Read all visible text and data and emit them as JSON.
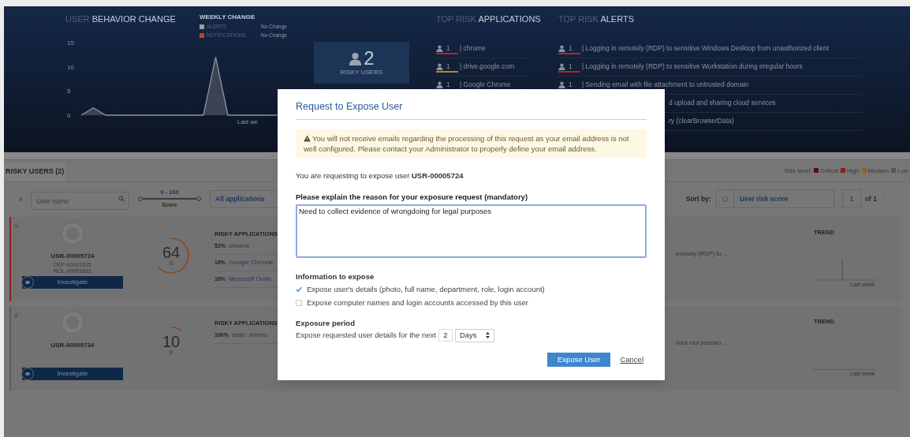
{
  "header": {
    "behavior": {
      "title": "USER **BEHAVIOR CHANGE**",
      "axis_labels": [
        "15",
        "10",
        "5",
        "0"
      ],
      "period_label": "Last we"
    },
    "weekly": {
      "title": "WEEKLY CHANGE",
      "rows": [
        {
          "label": "ALERTS",
          "value": "No Change",
          "color": "#9a9a9a"
        },
        {
          "label": "NOTIFICATIONS",
          "value": "No Change",
          "color": "#b5451f"
        }
      ]
    },
    "risky_users": {
      "count": "2",
      "label": "RISKY USERS"
    },
    "apps": {
      "title": "TOP RISK **APPLICATIONS**",
      "rows": [
        {
          "count": "1",
          "text": "| chrome",
          "color": "#b3262b"
        },
        {
          "count": "1",
          "text": "| drive.google.com",
          "color": "#c2861f"
        },
        {
          "count": "1",
          "text": "| Google Chrome"
        }
      ]
    },
    "alerts": {
      "title": "TOP RISK **ALERTS**",
      "rows": [
        {
          "count": "1",
          "text": "| Logging in remotely (RDP) to sensitive Windows Desktop from unauthorized client",
          "color": "#b3262b"
        },
        {
          "count": "1",
          "text": "| Logging in remotely (RDP) to sensitive Workstation during irregular hours",
          "color": "#b3262b"
        },
        {
          "count": "1",
          "text": "| Sending email with file attachment to untrusted domain"
        },
        {
          "text": "d upload and sharing cloud services"
        },
        {
          "text": "ry (clearBrowserData)"
        }
      ]
    }
  },
  "tab": {
    "label": "RISKY USERS (2)",
    "selected": true
  },
  "legend": {
    "label": "Risk level:",
    "items": [
      {
        "label": "Critical",
        "color": "#5a0d0d"
      },
      {
        "label": "High",
        "color": "#8f1c1c"
      },
      {
        "label": "Medium",
        "color": "#8f6420"
      },
      {
        "label": "Low",
        "color": "#555555"
      }
    ]
  },
  "filters": {
    "search": {
      "placeholder": "User name"
    },
    "score": {
      "range": "0 - 100",
      "label": "Score",
      "level": 1
    },
    "applications": "All applications",
    "sort_label": "Sort by:",
    "sort_value": "User risk score",
    "page": "1",
    "of": "of 1"
  },
  "users": [
    {
      "id": "USR-00005724",
      "dept": "DEP-90001625",
      "role": "ROL-90001631",
      "score": "64",
      "delta": "0",
      "color": "#8f2020",
      "action": "Investigate",
      "apps_title": "RISKY APPLICATIONS",
      "apps": [
        {
          "pct": "52%",
          "name": "chrome"
        },
        {
          "pct": "16%",
          "name": "Google Chrome"
        },
        {
          "pct": "16%",
          "name": "Microsoft Outlo"
        }
      ],
      "alert": "emotely (RDP) to ...",
      "trend": "TREND",
      "trend_label": "Last week"
    },
    {
      "id": "USR-00005734",
      "score": "10",
      "delta": "0",
      "color": "#5a5a5a",
      "action": "Investigate",
      "apps_title": "RISKY APPLICATIONS",
      "apps": [
        {
          "pct": "100%",
          "name": "sudo: /bin/su"
        }
      ],
      "alert": "hout root passwo...",
      "trend": "TREND",
      "trend_label": "Last week"
    }
  ],
  "dialog": {
    "title": "Request to Expose User",
    "warning": "You will not receive emails regarding the processing of this request as your email address is not well configured. Please contact your Administrator to properly define your email address.",
    "request": "You are requesting to expose user **USR-00005724**",
    "reason_label": "Please explain the reason for your exposure request (mandatory)",
    "reason": "Need to collect evidence of wrongdoing for legal purposes",
    "info_label": "Information to expose",
    "options": [
      {
        "label": "Expose user's details (photo, full name, department, role, login account)",
        "checked": true
      },
      {
        "label": "Expose computer names and login accounts accessed by this user",
        "checked": false
      }
    ],
    "period_label": "Exposure period",
    "period_text": "Expose requested user details for the next",
    "period_value": "2",
    "period_unit": "Days",
    "submit": "Expose User",
    "cancel": "Cancel"
  }
}
